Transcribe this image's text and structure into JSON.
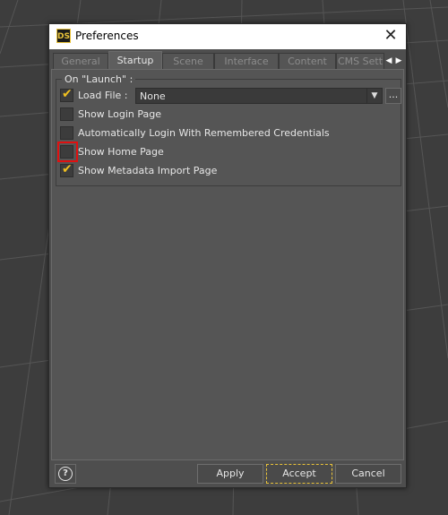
{
  "window": {
    "logo_text": "DS",
    "title": "Preferences",
    "close_glyph": "✕"
  },
  "tabs": [
    {
      "label": "General",
      "active": false
    },
    {
      "label": "Startup",
      "active": true
    },
    {
      "label": "Scene",
      "active": false
    },
    {
      "label": "Interface",
      "active": false
    },
    {
      "label": "Content",
      "active": false
    },
    {
      "label": "CMS Sett",
      "active": false
    }
  ],
  "tab_scroll": {
    "left_glyph": "◀",
    "right_glyph": "▶"
  },
  "group": {
    "title": "On \"Launch\" :",
    "load_file": {
      "label": "Load File :",
      "checked": true,
      "value": "None",
      "ellipsis": "..."
    },
    "options": [
      {
        "label": "Show Login Page",
        "checked": false
      },
      {
        "label": "Automatically Login With Remembered Credentials",
        "checked": false
      },
      {
        "label": "Show Home Page",
        "checked": false,
        "highlighted": true
      },
      {
        "label": "Show Metadata Import Page",
        "checked": true
      }
    ]
  },
  "footer": {
    "help_glyph": "?",
    "apply_label": "Apply",
    "accept_label": "Accept",
    "cancel_label": "Cancel"
  },
  "colors": {
    "accent": "#e8c23a",
    "highlight": "#e01010",
    "background": "#3f3f3f"
  },
  "icons": [
    "daz-studio-logo",
    "close-icon",
    "tab-scroll-left-icon",
    "tab-scroll-right-icon",
    "dropdown-arrow-icon",
    "checkmark-icon",
    "help-icon"
  ]
}
